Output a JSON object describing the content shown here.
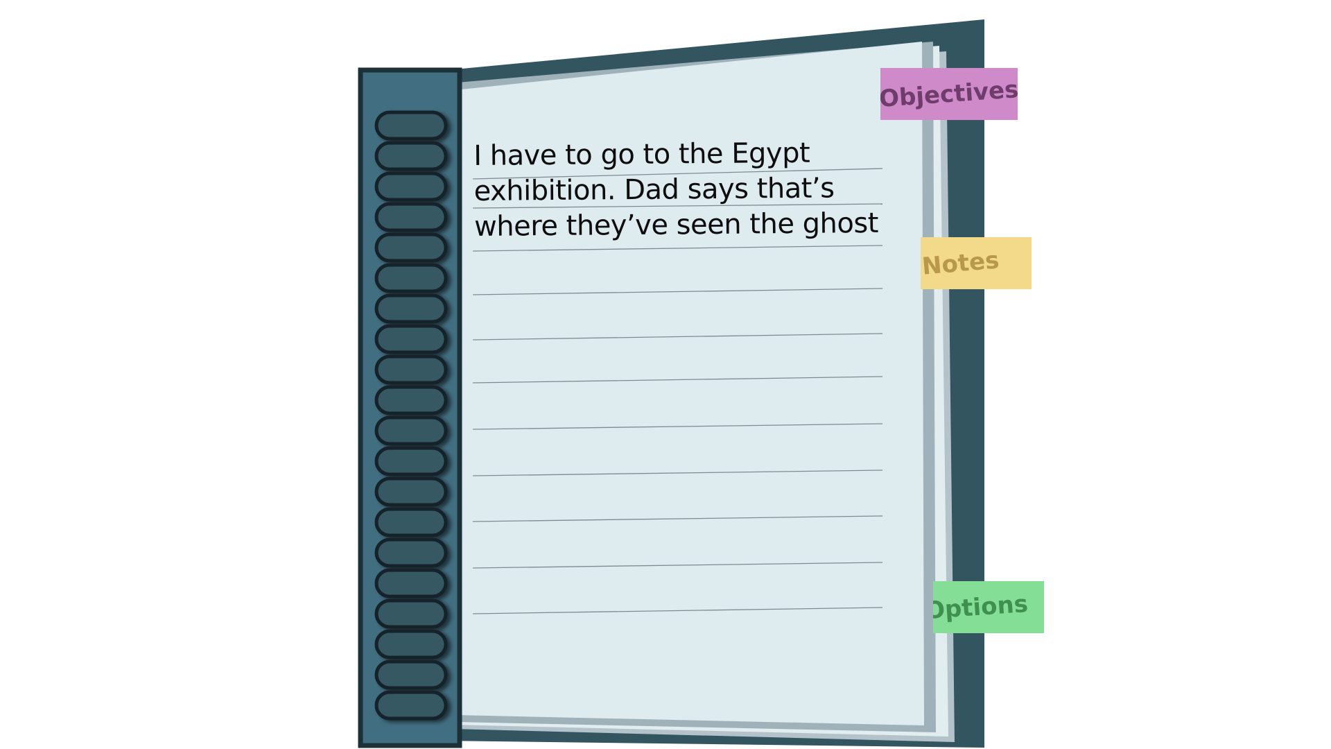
{
  "journal": {
    "entry_lines": [
      "I have to go to the Egypt",
      "exhibition. Dad says that’s",
      "where they’ve seen the ghost"
    ]
  },
  "tabs": {
    "objectives": {
      "label": "Objectives",
      "bg": "#cf8ac9",
      "fg": "#6e3d6c"
    },
    "notes": {
      "label": "Notes",
      "bg": "#f3d98a",
      "fg": "#b8994a"
    },
    "options": {
      "label": "Options",
      "bg": "#84de95",
      "fg": "#3f8f4f"
    }
  },
  "colors": {
    "cover": "#325560",
    "spine": "#416e80",
    "spine_border": "#1c3038",
    "page": "#deebef",
    "page_edges": "#9fb2ba",
    "ruled_line": "#7d8c92",
    "ring": "#345862"
  },
  "icons": [
    "spiral-binding-icon"
  ]
}
